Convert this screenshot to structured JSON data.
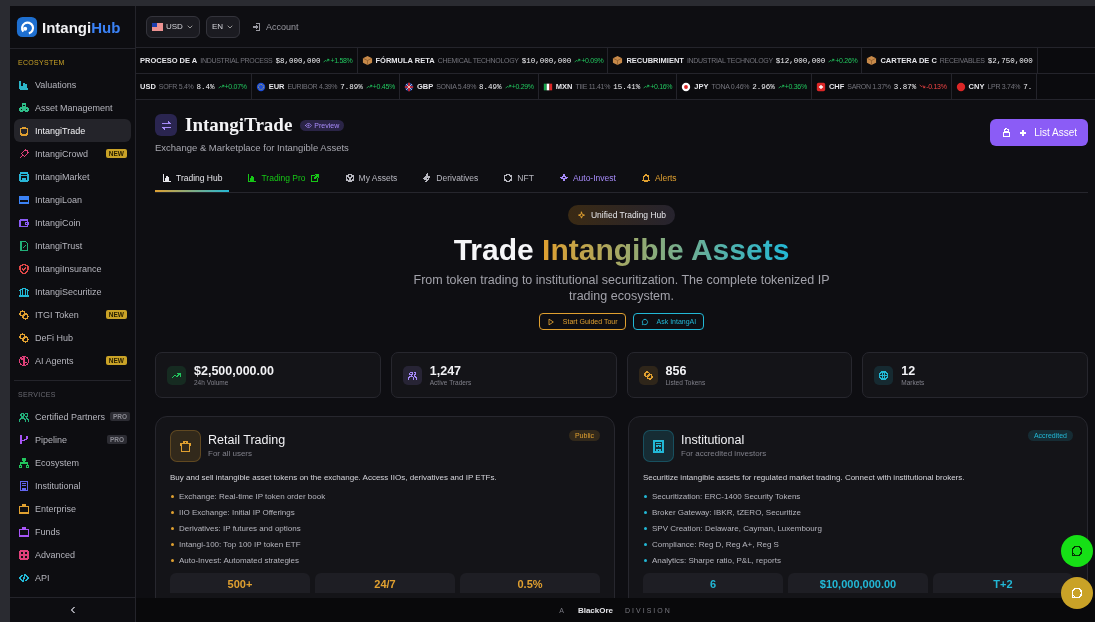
{
  "logo": {
    "text": "Intangi",
    "accent": "Hub"
  },
  "topbar": {
    "currency": "USD",
    "language": "EN",
    "account": "Account"
  },
  "ticker_assets": [
    {
      "name": "PROCESO DE A",
      "category": "INDUSTRIAL PROCESS",
      "price": "$8,000,000",
      "change": "+1.58%",
      "negative": false,
      "icon_visible": false
    },
    {
      "name": "FÓRMULA RETA",
      "category": "CHEMICAL TECHNOLOGY",
      "price": "$10,000,000",
      "change": "+0.09%",
      "negative": false,
      "icon_visible": true
    },
    {
      "name": "RECUBRIMIENT",
      "category": "INDUSTRIAL TECHNOLOGY",
      "price": "$12,000,000",
      "change": "+0.26%",
      "negative": false,
      "icon_visible": true
    },
    {
      "name": "CARTERA DE C",
      "category": "RECEIVABLES",
      "price": "$2,750,000",
      "icon_visible": true
    }
  ],
  "ticker_rates": [
    {
      "currency": "USD",
      "benchmark": "SOFR 5.4%",
      "rate": "8.4%",
      "change": "+0.07%",
      "negative": false
    },
    {
      "currency": "EUR",
      "benchmark": "EURIBOR 4.39%",
      "rate": "7.89%",
      "change": "+0.45%",
      "negative": false
    },
    {
      "currency": "GBP",
      "benchmark": "SONIA 5.49%",
      "rate": "8.49%",
      "change": "+0.29%",
      "negative": false
    },
    {
      "currency": "MXN",
      "benchmark": "TIIE 11.41%",
      "rate": "15.41%",
      "change": "+0.16%",
      "negative": false
    },
    {
      "currency": "JPY",
      "benchmark": "TONA 0.46%",
      "rate": "2.96%",
      "change": "+0.36%",
      "negative": false
    },
    {
      "currency": "CHF",
      "benchmark": "SARON 1.37%",
      "rate": "3.87%",
      "change": "-0.13%",
      "negative": true
    },
    {
      "currency": "CNY",
      "benchmark": "LPR 3.74%",
      "rate": "7."
    }
  ],
  "sidebar": {
    "sections": [
      {
        "title": "ECOSYSTEM",
        "items": [
          {
            "label": "Valuations",
            "selected": false,
            "color": "#2bb5c9"
          },
          {
            "label": "Asset Management",
            "selected": false,
            "color": "#2fbf8a"
          },
          {
            "label": "IntangiTrade",
            "selected": true,
            "color": "#e0a030"
          },
          {
            "label": "IntangiCrowd",
            "selected": false,
            "color": "#e0407a",
            "badge": "NEW"
          },
          {
            "label": "IntangiMarket",
            "selected": false,
            "color": "#29b6d8"
          },
          {
            "label": "IntangiLoan",
            "selected": false,
            "color": "#3b82f6"
          },
          {
            "label": "IntangiCoin",
            "selected": false,
            "color": "#8b5cf6"
          },
          {
            "label": "IntangiTrust",
            "selected": false,
            "color": "#22b07a"
          },
          {
            "label": "IntangiInsurance",
            "selected": false,
            "color": "#e04848"
          },
          {
            "label": "IntangiSecuritize",
            "selected": false,
            "color": "#22b8d6"
          },
          {
            "label": "ITGI Token",
            "selected": false,
            "color": "#e0a030",
            "badge": "NEW"
          },
          {
            "label": "DeFi Hub",
            "selected": false,
            "color": "#e0a030"
          },
          {
            "label": "AI Agents",
            "selected": false,
            "color": "#e0407a",
            "badge": "NEW"
          }
        ]
      },
      {
        "title": "SERVICES",
        "items": [
          {
            "label": "Certified Partners",
            "selected": false,
            "color": "#22b07a",
            "badge": "PRO"
          },
          {
            "label": "Pipeline",
            "selected": false,
            "color": "#a855f7",
            "badge": "PRO"
          },
          {
            "label": "Ecosystem",
            "selected": false,
            "color": "#22c55e"
          },
          {
            "label": "Institutional",
            "selected": false,
            "color": "#6366f1"
          },
          {
            "label": "Enterprise",
            "selected": false,
            "color": "#e0a030"
          },
          {
            "label": "Funds",
            "selected": false,
            "color": "#a855f7"
          },
          {
            "label": "Advanced",
            "selected": false,
            "color": "#e0407a"
          },
          {
            "label": "API",
            "selected": false,
            "color": "#22b8d6"
          }
        ]
      }
    ]
  },
  "header": {
    "title": "IntangiTrade",
    "badge": "Preview",
    "subtitle": "Exchange & Marketplace for Intangible Assets",
    "action": "List Asset"
  },
  "tabs": [
    {
      "label": "Trading Hub",
      "selected": true,
      "color": "#e6e6ea",
      "external": false
    },
    {
      "label": "Trading Pro",
      "selected": false,
      "color": "#16c716",
      "external": true
    },
    {
      "label": "My Assets",
      "selected": false,
      "color": "#b8b8c0",
      "external": false
    },
    {
      "label": "Derivatives",
      "selected": false,
      "color": "#b8b8c0",
      "external": false
    },
    {
      "label": "NFT",
      "selected": false,
      "color": "#b8b8c0",
      "external": false
    },
    {
      "label": "Auto-Invest",
      "selected": false,
      "color": "#a78bfa",
      "external": false
    },
    {
      "label": "Alerts",
      "selected": false,
      "color": "#e0a030",
      "external": false
    }
  ],
  "hero": {
    "badge": "Unified Trading Hub",
    "title": "Trade",
    "title_highlight": "Intangible Assets",
    "subtitle": "From token trading to institutional securitization. The complete tokenized IP trading ecosystem.",
    "buttons": [
      {
        "label": "Start Guided Tour",
        "color": "#e0a030"
      },
      {
        "label": "Ask IntangAI",
        "color": "#22b8d6"
      }
    ]
  },
  "stats": [
    {
      "value": "$2,500,000.00",
      "label": "24h Volume",
      "color": "#22c55e"
    },
    {
      "value": "1,247",
      "label": "Active Traders",
      "color": "#a78bfa"
    },
    {
      "value": "856",
      "label": "Listed Tokens",
      "color": "#e0a030"
    },
    {
      "value": "12",
      "label": "Markets",
      "color": "#22b8d6"
    }
  ],
  "cards": [
    {
      "title": "Retail Trading",
      "subtitle": "For all users",
      "badge": "Public",
      "color": "#e0a030",
      "description": "Buy and sell intangible asset tokens on the exchange. Access IIOs, derivatives and IP ETFs.",
      "features": [
        "Exchange: Real-time IP token order book",
        "IIO Exchange: Initial IP Offerings",
        "Derivatives: IP futures and options",
        "Intangi-100: Top 100 IP token ETF",
        "Auto-Invest: Automated strategies"
      ],
      "metrics": [
        "500+",
        "24/7",
        "0.5%"
      ]
    },
    {
      "title": "Institutional",
      "subtitle": "For accredited investors",
      "badge": "Accredited",
      "color": "#22b8d6",
      "description": "Securitize intangible assets for regulated market trading. Connect with institutional brokers.",
      "features": [
        "Securitization: ERC-1400 Security Tokens",
        "Broker Gateway: IBKR, tZERO, Securitize",
        "SPV Creation: Delaware, Cayman, Luxembourg",
        "Compliance: Reg D, Reg A+, Reg S",
        "Analytics: Sharpe ratio, P&L, reports"
      ],
      "metrics": [
        "6",
        "$10,000,000.00",
        "T+2"
      ]
    }
  ],
  "footer": {
    "prefix": "A",
    "brand": "BlackOre",
    "suffix": "DIVISION"
  },
  "chat_buttons": [
    {
      "color": "#16e016"
    },
    {
      "color": "#c9a227"
    }
  ]
}
